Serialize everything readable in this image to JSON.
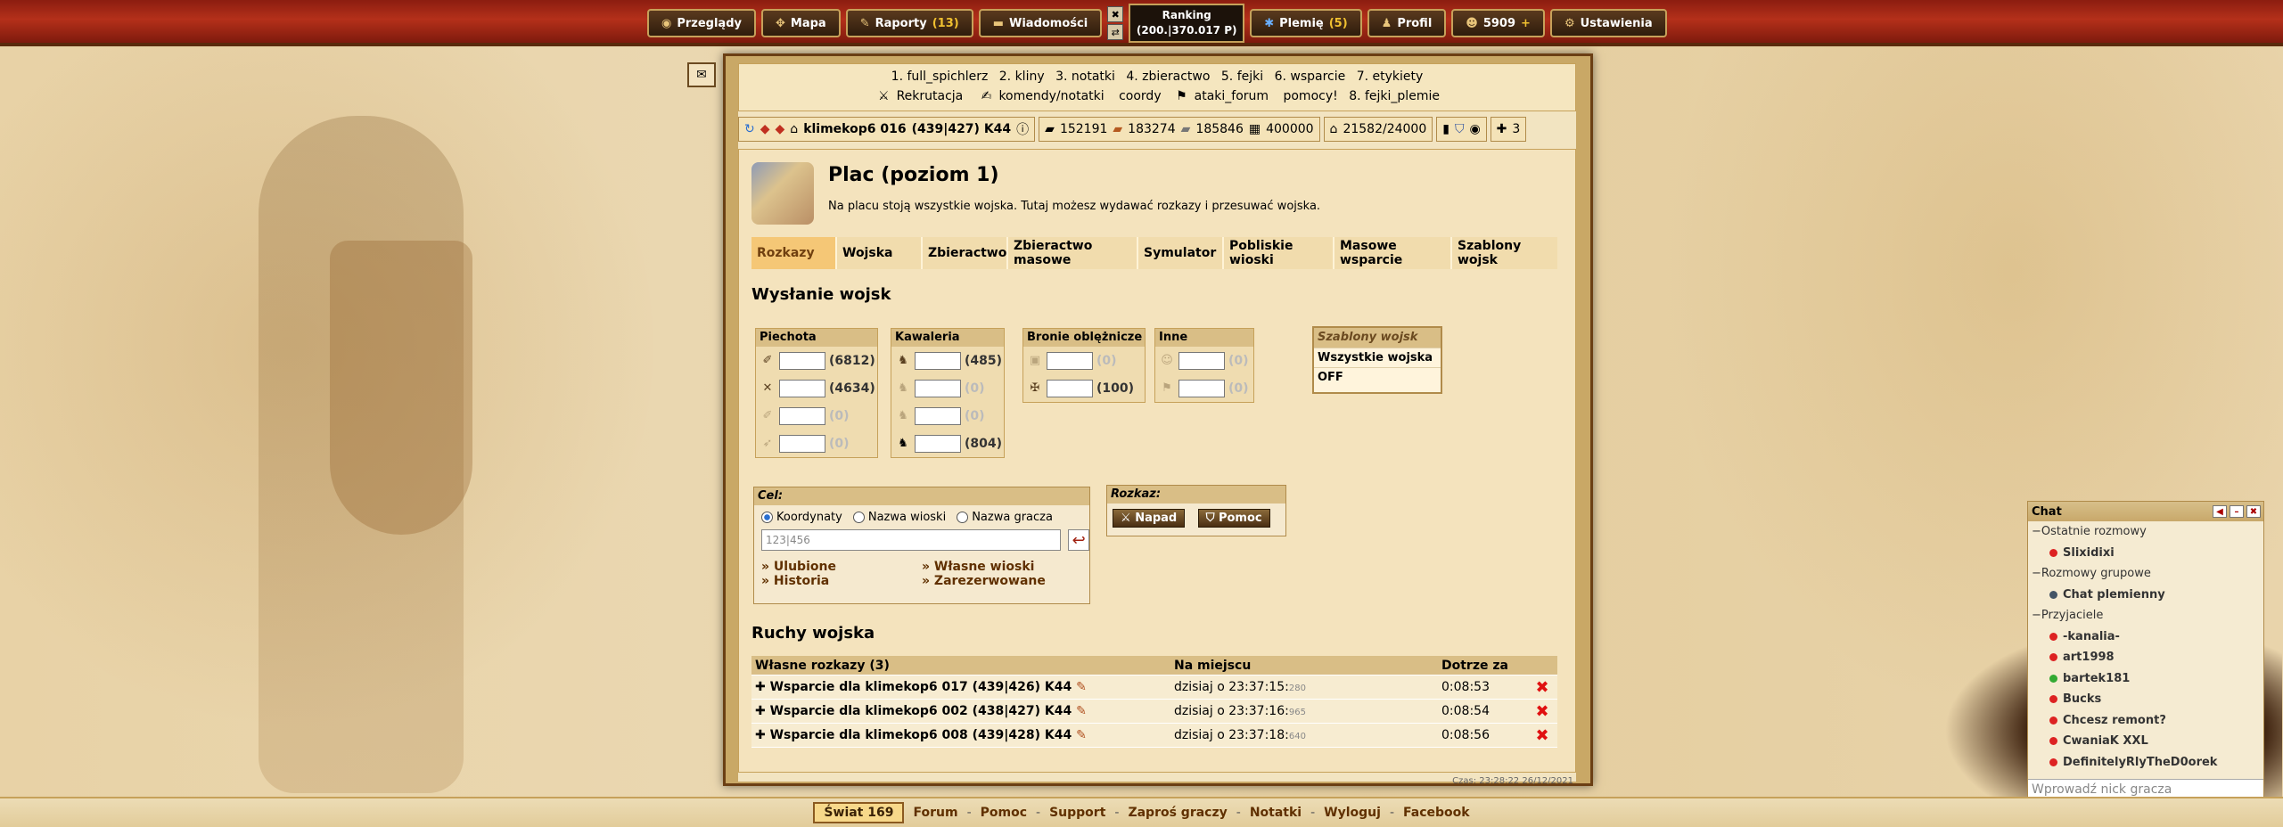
{
  "topbar": {
    "menu": [
      {
        "label": "Przeglądy",
        "icon": "eye-icon",
        "badge": ""
      },
      {
        "label": "Mapa",
        "icon": "map-icon",
        "badge": ""
      },
      {
        "label": "Raporty",
        "icon": "reports-icon",
        "badge": "(13)"
      },
      {
        "label": "Wiadomości",
        "icon": "mail-icon",
        "badge": ""
      }
    ],
    "ranking_title": "Ranking",
    "ranking_value": "(200.|370.017 P)",
    "menu2": [
      {
        "label": "Plemię",
        "icon": "tribe-icon",
        "badge": "(5)"
      },
      {
        "label": "Profil",
        "icon": "profile-icon",
        "badge": ""
      },
      {
        "label": "5909",
        "icon": "premium-icon",
        "badge": "+"
      },
      {
        "label": "Ustawienia",
        "icon": "settings-icon",
        "badge": ""
      }
    ]
  },
  "quickbar": {
    "row1": [
      "1. full_spichlerz",
      "2. kliny",
      "3. notatki",
      "4. zbieractwo",
      "5. fejki",
      "6. wsparcie",
      "7. etykiety"
    ],
    "row2": [
      "Rekrutacja",
      "komendy/notatki",
      "coordy",
      "ataki_forum",
      "pomocy!",
      "8. fejki_plemie"
    ]
  },
  "village": {
    "name": "klimekop6 016",
    "coords": "(439|427) K44"
  },
  "resources": {
    "wood": "152191",
    "clay": "183274",
    "iron": "185846",
    "storage": "400000",
    "pop": "21582/24000",
    "extra": "3"
  },
  "page": {
    "title": "Plac (poziom 1)",
    "description": "Na placu stoją wszystkie wojska. Tutaj możesz wydawać rozkazy i przesuwać wojska.",
    "tabs": [
      "Rozkazy",
      "Wojska",
      "Zbieractwo",
      "Zbieractwo masowe",
      "Symulator",
      "Pobliskie wioski",
      "Masowe wsparcie",
      "Szablony wojsk"
    ],
    "send_heading": "Wysłanie wojsk"
  },
  "units": {
    "piechota": {
      "label": "Piechota",
      "counts": [
        "(6812)",
        "(4634)",
        "(0)",
        "(0)"
      ]
    },
    "kawaleria": {
      "label": "Kawaleria",
      "counts": [
        "(485)",
        "(0)",
        "(0)",
        "(804)"
      ]
    },
    "bronie": {
      "label": "Bronie oblężnicze",
      "counts": [
        "(0)",
        "(100)"
      ]
    },
    "inne": {
      "label": "Inne",
      "counts": [
        "(0)",
        "(0)"
      ]
    }
  },
  "templates": {
    "title": "Szablony wojsk",
    "options": [
      "Wszystkie wojska",
      "OFF"
    ]
  },
  "target": {
    "title": "Cel:",
    "radios": [
      "Koordynaty",
      "Nazwa wioski",
      "Nazwa gracza"
    ],
    "placeholder": "123|456",
    "links": [
      "Ulubione",
      "Własne wioski",
      "Historia",
      "Zarezerwowane"
    ]
  },
  "order": {
    "title": "Rozkaz:",
    "attack": "Napad",
    "support": "Pomoc"
  },
  "movements": {
    "heading": "Ruchy wojska",
    "headers": [
      "Własne rozkazy (3)",
      "Na miejscu",
      "Dotrze za"
    ],
    "rows": [
      {
        "name": "Wsparcie dla klimekop6 017 (439|426) K44",
        "time": "dzisiaj o 23:37:15:",
        "ms": "280",
        "eta": "0:08:53"
      },
      {
        "name": "Wsparcie dla klimekop6 002 (438|427) K44",
        "time": "dzisiaj o 23:37:16:",
        "ms": "965",
        "eta": "0:08:54"
      },
      {
        "name": "Wsparcie dla klimekop6 008 (439|428) K44",
        "time": "dzisiaj o 23:37:18:",
        "ms": "640",
        "eta": "0:08:56"
      }
    ]
  },
  "servertime": "Czas: 23:28:22 26/12/2021",
  "footer": {
    "world": "Świat 169",
    "links": [
      "Forum",
      "Pomoc",
      "Support",
      "Zaproś graczy",
      "Notatki",
      "Wyloguj",
      "Facebook"
    ]
  },
  "chat": {
    "title": "Chat",
    "items": [
      {
        "type": "grp",
        "label": "Ostatnie rozmowy"
      },
      {
        "type": "usr",
        "label": "Slixidixi",
        "status": "#d22"
      },
      {
        "type": "grp",
        "label": "Rozmowy grupowe"
      },
      {
        "type": "usr",
        "label": "Chat plemienny",
        "status": "#456"
      },
      {
        "type": "grp",
        "label": "Przyjaciele"
      },
      {
        "type": "usr",
        "label": "-kanalia-",
        "status": "#d22"
      },
      {
        "type": "usr",
        "label": "art1998",
        "status": "#d22"
      },
      {
        "type": "usr",
        "label": "bartek181",
        "status": "#3a3"
      },
      {
        "type": "usr",
        "label": "Bucks",
        "status": "#d22"
      },
      {
        "type": "usr",
        "label": "Chcesz remont?",
        "status": "#d22"
      },
      {
        "type": "usr",
        "label": "CwaniaK XXL",
        "status": "#d22"
      },
      {
        "type": "usr",
        "label": "DefinitelyRlyTheD0orek",
        "status": "#d22"
      }
    ],
    "nick_placeholder": "Wprowadź nick gracza"
  }
}
